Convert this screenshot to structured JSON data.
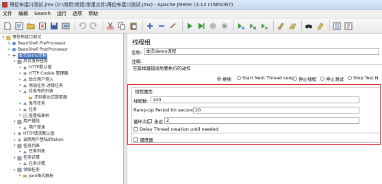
{
  "window": {
    "title": "哥伦布接口测试.jmx (D:\\常用\\常用\\常用文件\\哥伦布接口测试.jmx) - Apache JMeter (2.13 r1665067)"
  },
  "menu": [
    "文件",
    "编辑",
    "Search",
    "运行",
    "选项",
    "帮助"
  ],
  "toolbar_icons": [
    "new-icon",
    "templates-icon",
    "open-icon",
    "close-icon",
    "save-icon",
    "save-screenshot-icon",
    "undo-icon",
    "redo-icon",
    "cut-icon",
    "copy-icon",
    "paste-icon",
    "expand-icon",
    "collapse-icon",
    "toggle-icon",
    "start-icon",
    "start-no-pause-icon",
    "stop-icon",
    "shutdown-icon",
    "remote-start-icon",
    "remote-stop-icon",
    "remote-shutdown-icon",
    "clear-icon",
    "clear-all-icon",
    "search-icon",
    "reset-search-icon",
    "function-helper-icon",
    "help-icon"
  ],
  "tree": [
    {
      "label": "哥伦布接口测试",
      "level": 0,
      "icon": "testplan"
    },
    {
      "label": "BeanShell PreProcessor",
      "level": 1,
      "icon": "beanshell"
    },
    {
      "label": "BeanShell PostProcessor",
      "level": 1,
      "icon": "beanshell"
    },
    {
      "label": "本次demo流程",
      "level": 1,
      "icon": "thread",
      "selected": true
    },
    {
      "label": "后台发布任务",
      "level": 2,
      "icon": "controller"
    },
    {
      "label": "HTTP默认值",
      "level": 3,
      "icon": "config"
    },
    {
      "label": "HTTP Cookie 管理器",
      "level": 3,
      "icon": "config"
    },
    {
      "label": "后台用户登入",
      "level": 3,
      "icon": "sampler"
    },
    {
      "label": "添加任务-对接任务",
      "level": 3,
      "icon": "sampler"
    },
    {
      "label": "待发布的列表",
      "level": 3,
      "icon": "sampler"
    },
    {
      "label": "正则表达式提取器",
      "level": 4,
      "icon": "extractor"
    },
    {
      "label": "发布任务",
      "level": 3,
      "icon": "sampler"
    },
    {
      "label": "任务",
      "level": 3,
      "icon": "sampler"
    },
    {
      "label": "查看结果树",
      "level": 3,
      "icon": "listener"
    },
    {
      "label": "用户登陆",
      "level": 2,
      "icon": "controller"
    },
    {
      "label": "用户登录",
      "level": 3,
      "icon": "sampler"
    },
    {
      "label": "HTTP请求默认值",
      "level": 2,
      "icon": "config"
    },
    {
      "label": "调用用户登陆的token",
      "level": 2,
      "icon": "sampler"
    },
    {
      "label": "任务列表",
      "level": 2,
      "icon": "controller"
    },
    {
      "label": "任务列表",
      "level": 3,
      "icon": "sampler"
    },
    {
      "label": "任务详情",
      "level": 2,
      "icon": "controller"
    },
    {
      "label": "任务详情",
      "level": 3,
      "icon": "sampler"
    },
    {
      "label": "领取任务",
      "level": 2,
      "icon": "controller"
    },
    {
      "label": "json格式解析",
      "level": 3,
      "icon": "extractor"
    }
  ],
  "panel": {
    "heading": "线程组",
    "name_label": "名称:",
    "name_value": "本次demo流程",
    "comment_label": "注释:",
    "error_section": "在取样器错误后要执行的动作",
    "actions": [
      {
        "label": "继续",
        "selected": true
      },
      {
        "label": "Start Next Thread Loop",
        "selected": false
      },
      {
        "label": "停止线程",
        "selected": false
      },
      {
        "label": "停止测试",
        "selected": false
      },
      {
        "label": "Stop Test N",
        "selected": false
      }
    ],
    "thread_props_title": "线程属性",
    "threads_label": "线程数:",
    "threads_value": "100",
    "rampup_label": "Ramp-Up Period (in seconds):",
    "rampup_value": "20",
    "loop_label": "循环次数",
    "forever_label": "永远",
    "loop_value": "2",
    "delay_label": "Delay Thread creation until needed",
    "scheduler_label": "调度器"
  },
  "colors": {
    "highlight_border": "#e02020",
    "selection": "#3d6bb5"
  }
}
